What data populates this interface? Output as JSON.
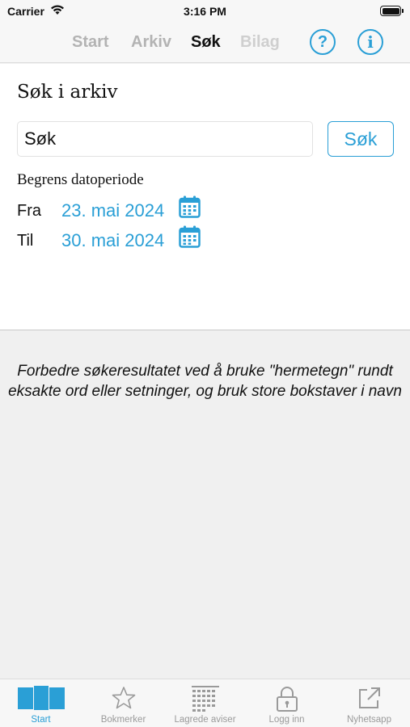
{
  "status_bar": {
    "carrier": "Carrier",
    "time": "3:16 PM"
  },
  "nav": {
    "tabs": [
      {
        "label": "Start"
      },
      {
        "label": "Arkiv"
      },
      {
        "label": "Søk",
        "active": true
      },
      {
        "label": "Bilag"
      }
    ],
    "help_symbol": "?",
    "info_symbol": "i"
  },
  "search": {
    "title": "Søk i arkiv",
    "input_value": "Søk",
    "button_label": "Søk",
    "limit_label": "Begrens datoperiode",
    "from_label": "Fra",
    "from_date": "23. mai 2024",
    "to_label": "Til",
    "to_date": "30. mai 2024"
  },
  "hint": "Forbedre søkeresultatet ved å bruke \"hermetegn\" rundt eksakte ord eller setninger, og bruk store bokstaver i navn",
  "tabbar": {
    "items": [
      {
        "label": "Start",
        "icon": "pages-icon",
        "active": true
      },
      {
        "label": "Bokmerker",
        "icon": "star-icon"
      },
      {
        "label": "Lagrede aviser",
        "icon": "grid-icon"
      },
      {
        "label": "Logg inn",
        "icon": "lock-icon"
      },
      {
        "label": "Nyhetsapp",
        "icon": "external-link-icon"
      }
    ]
  },
  "colors": {
    "accent": "#2a9fd6",
    "inactive": "#9a9a9a",
    "background": "#f0f0f0"
  }
}
